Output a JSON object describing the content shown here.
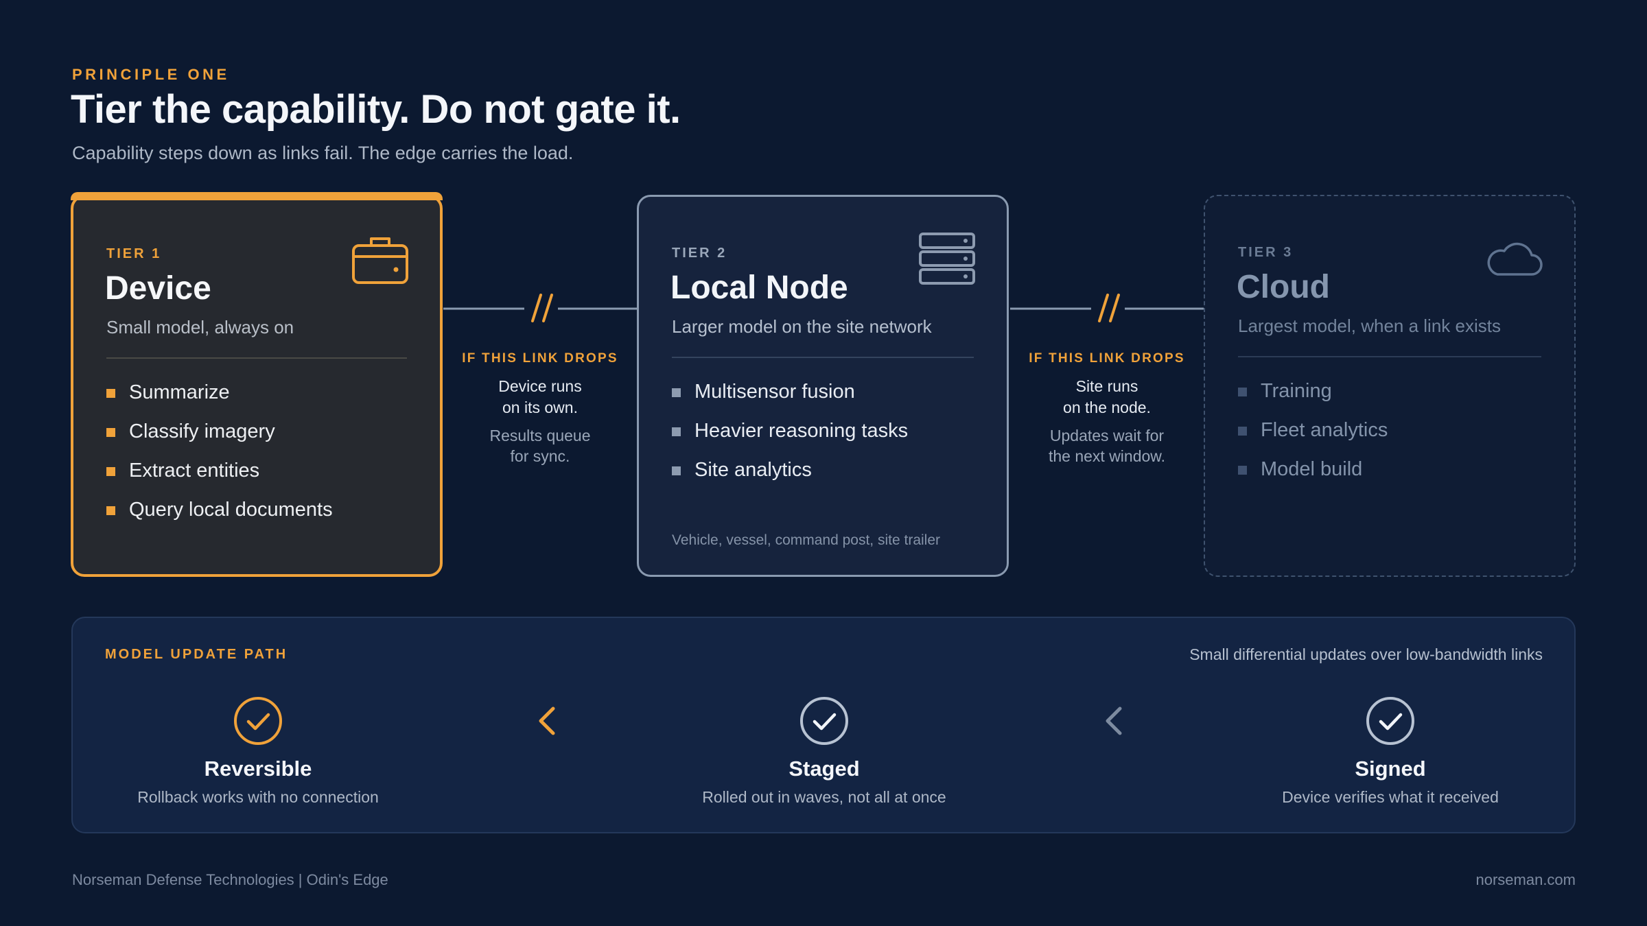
{
  "header": {
    "eyebrow": "PRINCIPLE ONE",
    "title": "Tier the capability. Do not gate it.",
    "subtitle": "Capability steps down as links fail. The edge carries the load."
  },
  "tiers": [
    {
      "label": "TIER 1",
      "name": "Device",
      "description": "Small model, always on",
      "icon": "toolbox-icon",
      "items": [
        "Summarize",
        "Classify imagery",
        "Extract entities",
        "Query local documents"
      ],
      "footnote": ""
    },
    {
      "label": "TIER 2",
      "name": "Local Node",
      "description": "Larger model on the site network",
      "icon": "server-rack-icon",
      "items": [
        "Multisensor fusion",
        "Heavier reasoning tasks",
        "Site analytics"
      ],
      "footnote": "Vehicle, vessel, command post, site trailer"
    },
    {
      "label": "TIER 3",
      "name": "Cloud",
      "description": "Largest model, when a link exists",
      "icon": "cloud-icon",
      "items": [
        "Training",
        "Fleet analytics",
        "Model build"
      ],
      "footnote": ""
    }
  ],
  "links": [
    {
      "heading": "IF THIS LINK DROPS",
      "main_1": "Device runs",
      "main_2": "on its own.",
      "sub_1": "Results queue",
      "sub_2": "for sync."
    },
    {
      "heading": "IF THIS LINK DROPS",
      "main_1": "Site runs",
      "main_2": "on the node.",
      "sub_1": "Updates wait for",
      "sub_2": "the next window."
    }
  ],
  "update_path": {
    "title": "MODEL UPDATE PATH",
    "note": "Small differential updates over low-bandwidth links",
    "steps": [
      {
        "title": "Reversible",
        "description": "Rollback works with no connection",
        "icon": "check-circle-icon"
      },
      {
        "title": "Staged",
        "description": "Rolled out in waves, not all at once",
        "icon": "check-circle-icon"
      },
      {
        "title": "Signed",
        "description": "Device verifies what it received",
        "icon": "check-circle-icon"
      }
    ]
  },
  "footer": {
    "left": "Norseman Defense Technologies | Odin's Edge",
    "right": "norseman.com"
  },
  "colors": {
    "background": "#0c1930",
    "accent": "#f0a23a",
    "tier1_card": "#26292f",
    "tier2_card": "#16233d",
    "panel": "#132443"
  }
}
